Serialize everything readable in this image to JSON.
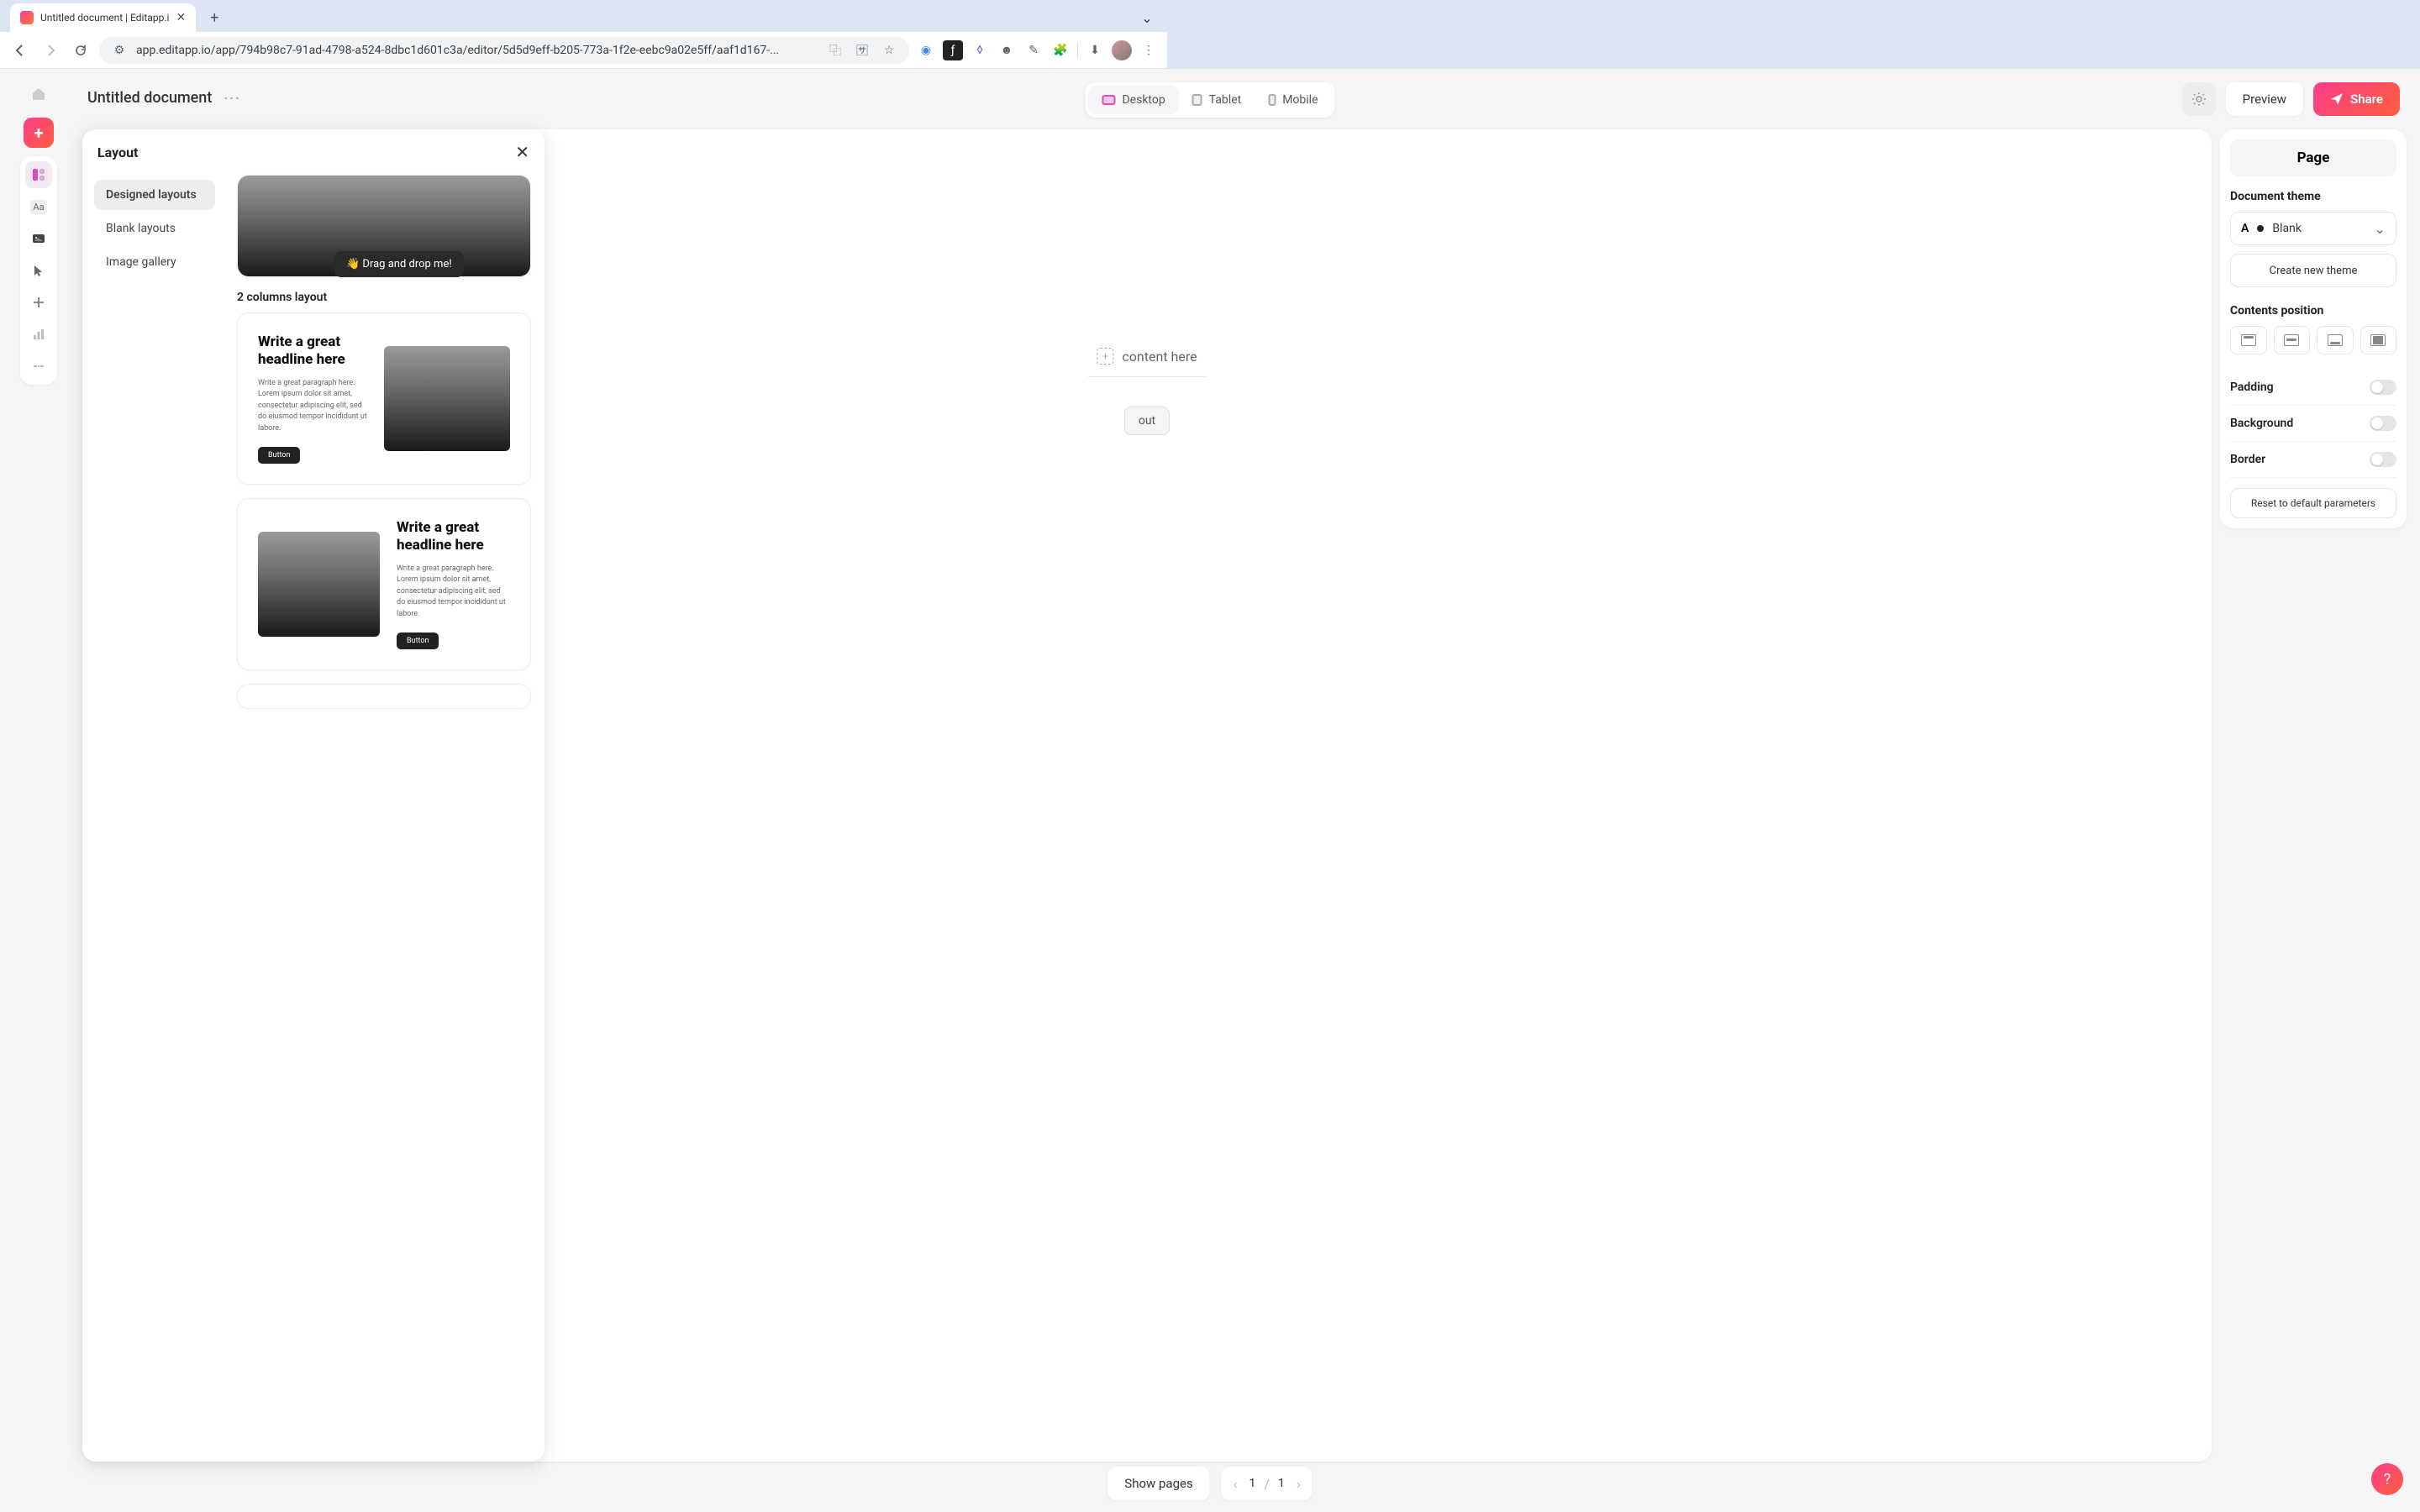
{
  "browser": {
    "tab_title": "Untitled document | Editapp.i",
    "url": "app.editapp.io/app/794b98c7-91ad-4798-a524-8dbc1d601c3a/editor/5d5d9eff-b205-773a-1f2e-eebc9a02e5ff/aaf1d167-..."
  },
  "toolbar": {
    "doc_title": "Untitled document",
    "devices": {
      "desktop": "Desktop",
      "tablet": "Tablet",
      "mobile": "Mobile"
    },
    "preview": "Preview",
    "share": "Share"
  },
  "layout_panel": {
    "title": "Layout",
    "tabs": {
      "designed": "Designed layouts",
      "blank": "Blank layouts",
      "gallery": "Image gallery"
    },
    "tooltip": "👋 Drag and drop me!",
    "section_2col": "2 columns layout",
    "sample_headline": "Write a great headline here",
    "sample_paragraph": "Write a great paragraph here. Lorem ipsum dolor sit amet, consectetur adipiscing elit, sed do eiusmod tempor incididunt ut labore.",
    "sample_button": "Button"
  },
  "canvas": {
    "placeholder": "content here",
    "layout_btn_suffix": "out"
  },
  "right_panel": {
    "title": "Page",
    "theme_section": "Document theme",
    "theme_value": "Blank",
    "create_theme": "Create new theme",
    "contents_position": "Contents position",
    "padding": "Padding",
    "background": "Background",
    "border": "Border",
    "reset": "Reset to default parameters"
  },
  "bottom": {
    "show_pages": "Show pages",
    "current": "1",
    "total": "1"
  },
  "help": "?"
}
